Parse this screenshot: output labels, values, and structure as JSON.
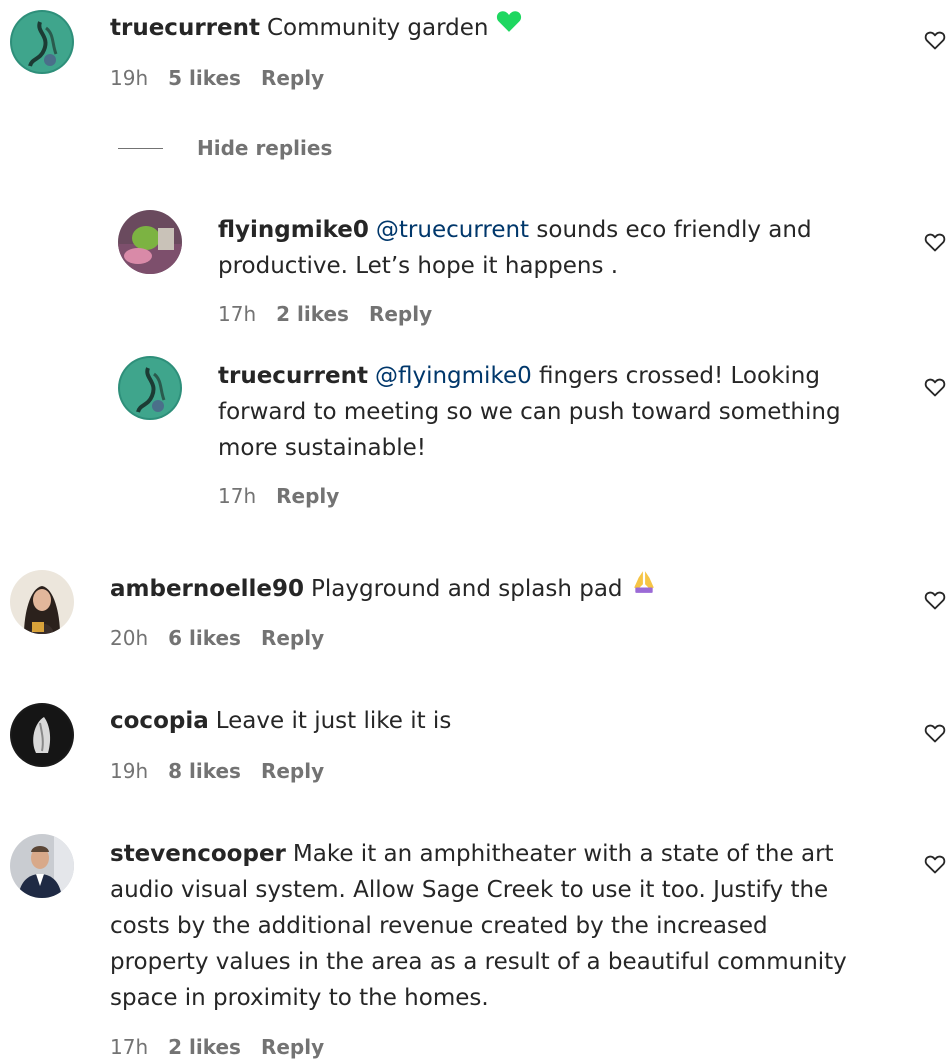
{
  "comments": [
    {
      "username": "truecurrent",
      "text": "Community garden",
      "emoji": "green-heart-emoji",
      "time": "19h",
      "likes": "5 likes",
      "reply": "Reply",
      "hide_replies": "Hide replies",
      "replies": [
        {
          "username": "flyingmike0",
          "mention": "@truecurrent",
          "text_line1": "sounds eco friendly and",
          "text_line2": "productive. Let’s hope it happens .",
          "time": "17h",
          "likes": "2 likes",
          "reply": "Reply"
        },
        {
          "username": "truecurrent",
          "mention": "@flyingmike0",
          "text_line1": "fingers crossed! Looking",
          "text_line2": "forward to meeting so we can push toward something",
          "text_line3": "more sustainable!",
          "time": "17h",
          "reply": "Reply"
        }
      ]
    },
    {
      "username": "ambernoelle90",
      "text": "Playground and splash pad",
      "emoji": "folded-hands-emoji",
      "time": "20h",
      "likes": "6 likes",
      "reply": "Reply"
    },
    {
      "username": "cocopia",
      "text": "Leave it just like it is",
      "time": "19h",
      "likes": "8 likes",
      "reply": "Reply"
    },
    {
      "username": "stevencooper",
      "text_line1": "Make it an amphitheater with a state of the art",
      "text_line2": "audio visual system. Allow Sage Creek to use it too. Justify the",
      "text_line3": "costs by the additional revenue created by the increased",
      "text_line4": "property values in the area as a result of a beautiful community",
      "text_line5": "space in proximity to the homes.",
      "time": "17h",
      "likes": "2 likes",
      "reply": "Reply"
    }
  ],
  "colors": {
    "text": "#262626",
    "secondary": "#737373",
    "mention": "#00376b",
    "green_heart": "#1ed760"
  }
}
